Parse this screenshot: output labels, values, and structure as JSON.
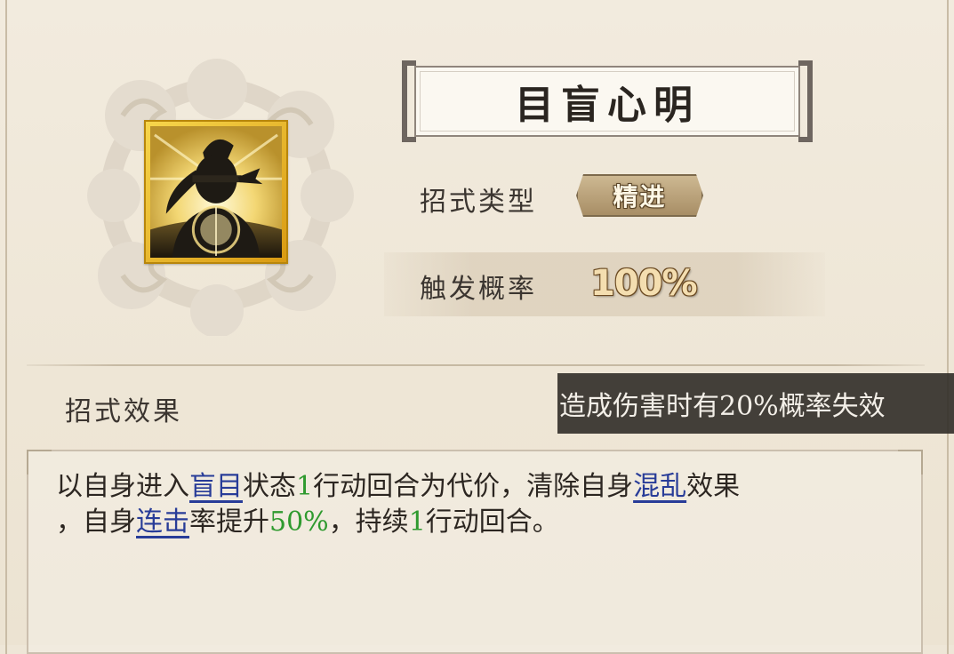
{
  "skill": {
    "name": "目盲心明",
    "icon": "blindfolded-monk-icon"
  },
  "rows": {
    "type_label": "招式类型",
    "type_value": "精进",
    "prob_label": "触发概率",
    "prob_value": "100%"
  },
  "effect": {
    "label": "招式效果",
    "tooltip": "造成伤害时有20%概率失效",
    "line1": [
      {
        "t": "以自身进入",
        "k": "text"
      },
      {
        "t": "盲目",
        "k": "kw"
      },
      {
        "t": "状态",
        "k": "text"
      },
      {
        "t": "1",
        "k": "num"
      },
      {
        "t": "行动回合为代价，清除自身",
        "k": "text"
      },
      {
        "t": "混乱",
        "k": "kw"
      },
      {
        "t": "效果",
        "k": "text"
      }
    ],
    "line2": [
      {
        "t": "，自身",
        "k": "text"
      },
      {
        "t": "连击",
        "k": "kw"
      },
      {
        "t": "率提升",
        "k": "text"
      },
      {
        "t": "50%",
        "k": "num"
      },
      {
        "t": "，持续",
        "k": "text"
      },
      {
        "t": "1",
        "k": "num"
      },
      {
        "t": "行动回合。",
        "k": "text"
      }
    ]
  },
  "colors": {
    "keyword": "#283c98",
    "number": "#2f9a2f",
    "icon_frame": "#f0c21e"
  }
}
